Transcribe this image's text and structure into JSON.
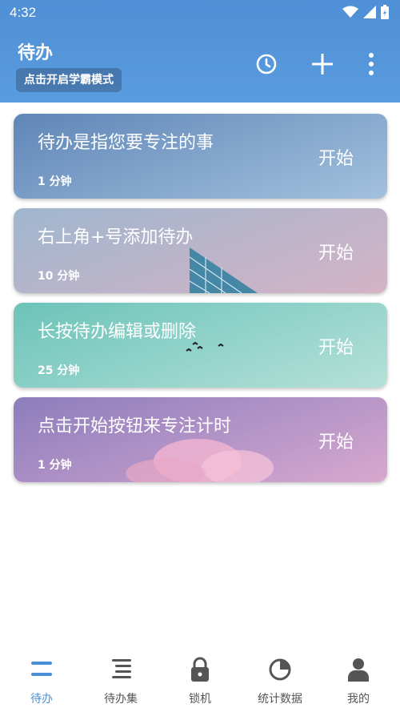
{
  "status_bar": {
    "time": "4:32"
  },
  "header": {
    "title": "待办",
    "mode_button": "点击开启学霸模式",
    "icons": [
      "clock-icon",
      "plus-icon",
      "more-vert-icon"
    ]
  },
  "cards": [
    {
      "title": "待办是指您要专注的事",
      "duration": "1 分钟",
      "start": "开始",
      "colors": [
        "#5f86b8",
        "#a3c1dd"
      ]
    },
    {
      "title": "右上角+号添加待办",
      "duration": "10 分钟",
      "start": "开始",
      "colors": [
        "#9fb6cf",
        "#d5b3c5"
      ]
    },
    {
      "title": "长按待办编辑或删除",
      "duration": "25 分钟",
      "start": "开始",
      "colors": [
        "#6cc3b9",
        "#b5e1d8"
      ]
    },
    {
      "title": "点击开始按钮来专注计时",
      "duration": "1 分钟",
      "start": "开始",
      "colors": [
        "#8c7dbd",
        "#d7a8cf"
      ]
    }
  ],
  "bottom_nav": [
    {
      "label": "待办",
      "icon": "list-icon",
      "active": true
    },
    {
      "label": "待办集",
      "icon": "list-collection-icon",
      "active": false
    },
    {
      "label": "锁机",
      "icon": "lock-icon",
      "active": false
    },
    {
      "label": "统计数据",
      "icon": "pie-chart-icon",
      "active": false
    },
    {
      "label": "我的",
      "icon": "person-icon",
      "active": false
    }
  ],
  "colors": {
    "header": "#5696db",
    "active": "#4a8fd6",
    "inactive": "#555555"
  }
}
